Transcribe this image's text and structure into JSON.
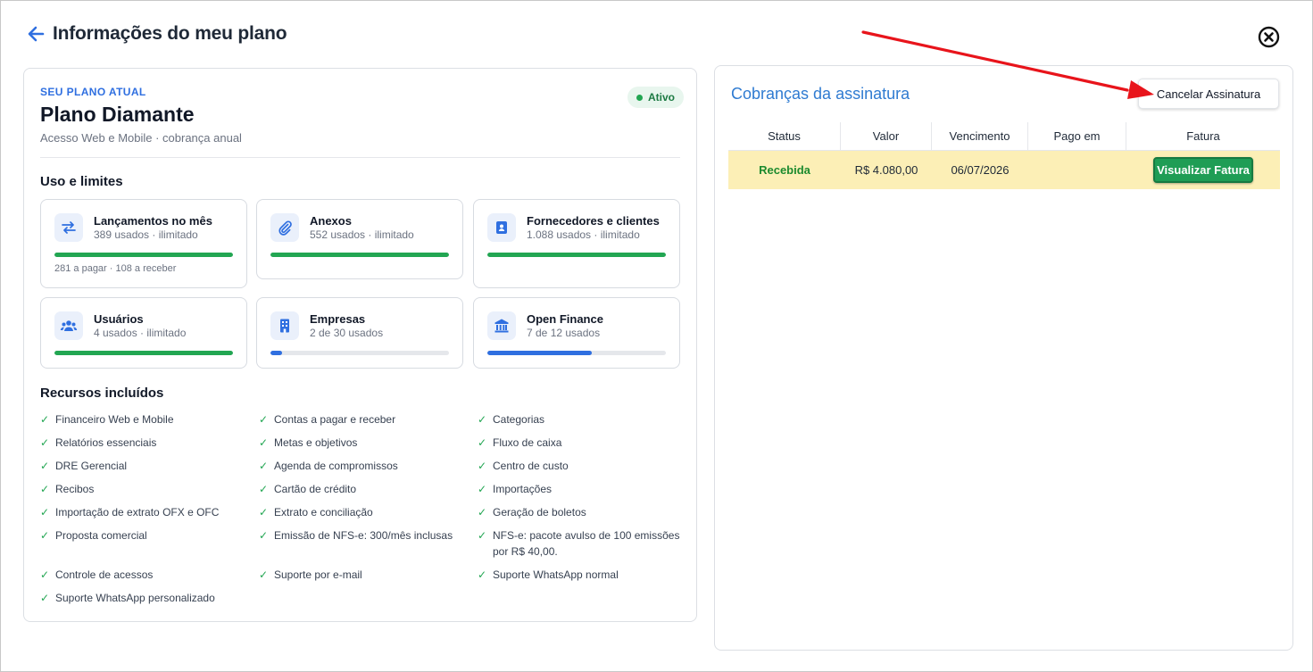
{
  "header": {
    "title": "Informações do meu plano"
  },
  "plan": {
    "eyebrow": "SEU PLANO ATUAL",
    "name": "Plano Diamante",
    "description": "Acesso Web e Mobile · cobrança anual",
    "status": "Ativo"
  },
  "usage": {
    "title": "Uso e limites",
    "items": [
      {
        "title": "Lançamentos no mês",
        "sub": "389 usados · ilimitado",
        "note": "281 a pagar · 108 a receber",
        "fill": 1.0,
        "color": "#22a652",
        "icon": "arrows-swap-icon"
      },
      {
        "title": "Anexos",
        "sub": "552 usados · ilimitado",
        "note": "",
        "fill": 1.0,
        "color": "#22a652",
        "icon": "paperclip-icon"
      },
      {
        "title": "Fornecedores e clientes",
        "sub": "1.088 usados · ilimitado",
        "note": "",
        "fill": 1.0,
        "color": "#22a652",
        "icon": "contact-book-icon"
      },
      {
        "title": "Usuários",
        "sub": "4 usados · ilimitado",
        "note": "",
        "fill": 1.0,
        "color": "#22a652",
        "icon": "users-icon"
      },
      {
        "title": "Empresas",
        "sub": "2 de 30 usados",
        "note": "",
        "fill": 0.0667,
        "color": "#2f6fe0",
        "icon": "building-icon"
      },
      {
        "title": "Open Finance",
        "sub": "7 de 12 usados",
        "note": "",
        "fill": 0.5833,
        "color": "#2f6fe0",
        "icon": "bank-icon"
      }
    ]
  },
  "features": {
    "title": "Recursos incluídos",
    "items": [
      "Financeiro Web e Mobile",
      "Contas a pagar e receber",
      "Categorias",
      "Relatórios essenciais",
      "Metas e objetivos",
      "Fluxo de caixa",
      "DRE Gerencial",
      "Agenda de compromissos",
      "Centro de custo",
      "Recibos",
      "Cartão de crédito",
      "Importações",
      "Importação de extrato OFX e OFC",
      "Extrato e conciliação",
      "Geração de boletos",
      "Proposta comercial",
      "Emissão de NFS-e: 300/mês inclusas",
      "NFS-e: pacote avulso de 100 emissões por R$ 40,00.",
      "Controle de acessos",
      "Suporte por e-mail",
      "Suporte WhatsApp normal",
      "Suporte WhatsApp personalizado"
    ]
  },
  "billing": {
    "title": "Cobranças da assinatura",
    "cancel_label": "Cancelar Assinatura",
    "columns": [
      "Status",
      "Valor",
      "Vencimento",
      "Pago em",
      "Fatura"
    ],
    "rows": [
      {
        "status": "Recebida",
        "valor": "R$ 4.080,00",
        "vencimento": "06/07/2026",
        "pago_em": "",
        "action_label": "Visualizar Fatura"
      }
    ]
  },
  "colors": {
    "accent": "#2f6fe0",
    "success": "#22a652",
    "row_highlight": "#fcefb6",
    "annotation": "#e8141b"
  }
}
